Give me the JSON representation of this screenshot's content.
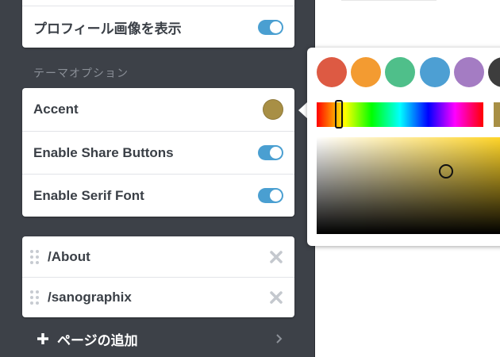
{
  "profile": {
    "label": "プロフィール画像を表示",
    "enabled": true
  },
  "theme": {
    "section_title": "テーマオプション",
    "accent": {
      "label": "Accent",
      "color": "#a88f45"
    },
    "share": {
      "label": "Enable Share Buttons",
      "enabled": true
    },
    "serif": {
      "label": "Enable Serif Font",
      "enabled": true
    }
  },
  "pages": {
    "items": [
      {
        "label": "/About",
        "icon": "drag-handle-icon",
        "remove_icon": "close-icon"
      },
      {
        "label": "/sanographix",
        "icon": "drag-handle-icon",
        "remove_icon": "close-icon"
      }
    ],
    "add_label": "ページの追加"
  },
  "color_picker": {
    "presets": [
      "#dd5a43",
      "#f39b31",
      "#4fbf8a",
      "#4d9fd3",
      "#a47cc3",
      "#3d3d3d"
    ],
    "selected_color": "#a88f45",
    "hue_color": "#ffd21a"
  },
  "colors": {
    "sidebar_bg": "#3d4148",
    "toggle_on": "#4a9fd1",
    "text": "#3a3f46"
  }
}
